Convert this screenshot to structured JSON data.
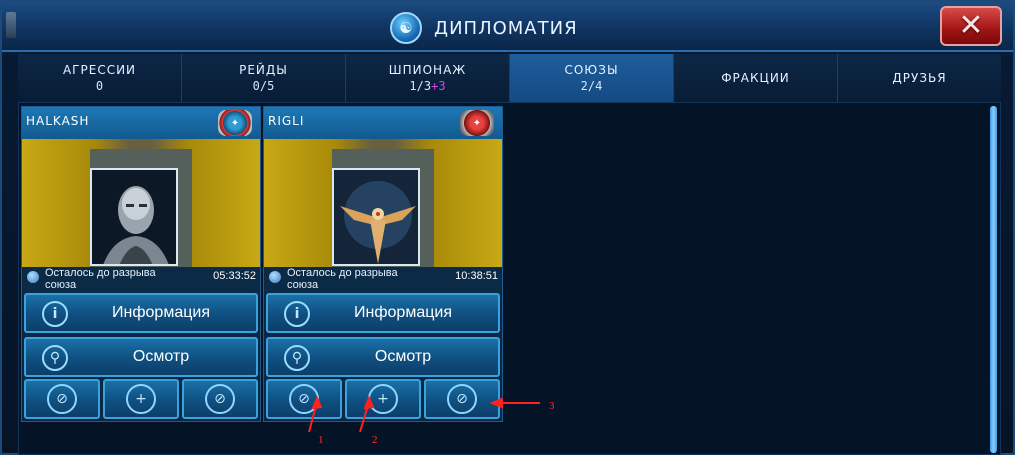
{
  "window": {
    "title": "ДИПЛОМАТИЯ",
    "close_label": "✕"
  },
  "tabs": [
    {
      "label": "АГРЕССИИ",
      "count": "0"
    },
    {
      "label": "РЕЙДЫ",
      "count": "0/5"
    },
    {
      "label": "ШПИОНАЖ",
      "count": "1/3",
      "extra": "+3"
    },
    {
      "label": "СОЮЗЫ",
      "count": "2/4",
      "active": true
    },
    {
      "label": "ФРАКЦИИ"
    },
    {
      "label": "ДРУЗЬЯ"
    }
  ],
  "cards": [
    {
      "name": "HALKASH",
      "status_text": "Осталось до разрыва союза",
      "timer": "05:33:52",
      "info_label": "Информация",
      "inspect_label": "Осмотр"
    },
    {
      "name": "RIGLI",
      "status_text": "Осталось до разрыва союза",
      "timer": "10:38:51",
      "info_label": "Информация",
      "inspect_label": "Осмотр"
    }
  ],
  "annotations": [
    "1",
    "2",
    "3"
  ],
  "colors": {
    "accent": "#3aa3de",
    "active_tab": "#1e5d9c",
    "arrow": "#ff2020"
  }
}
